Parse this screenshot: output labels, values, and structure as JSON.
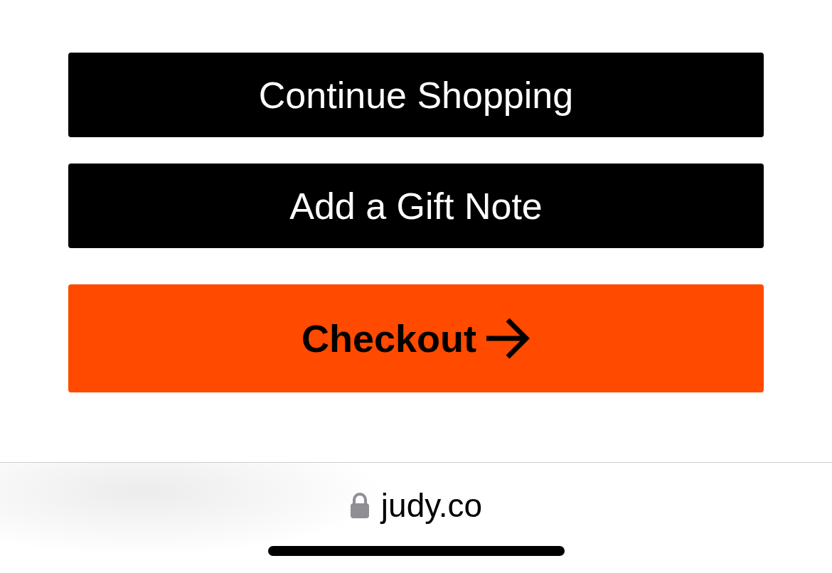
{
  "buttons": [
    {
      "label": "Continue Shopping",
      "kind": "secondary"
    },
    {
      "label": "Add a Gift Note",
      "kind": "secondary"
    },
    {
      "label": "Checkout",
      "kind": "primary"
    }
  ],
  "address_bar": {
    "domain": "judy.co",
    "secure": true
  }
}
